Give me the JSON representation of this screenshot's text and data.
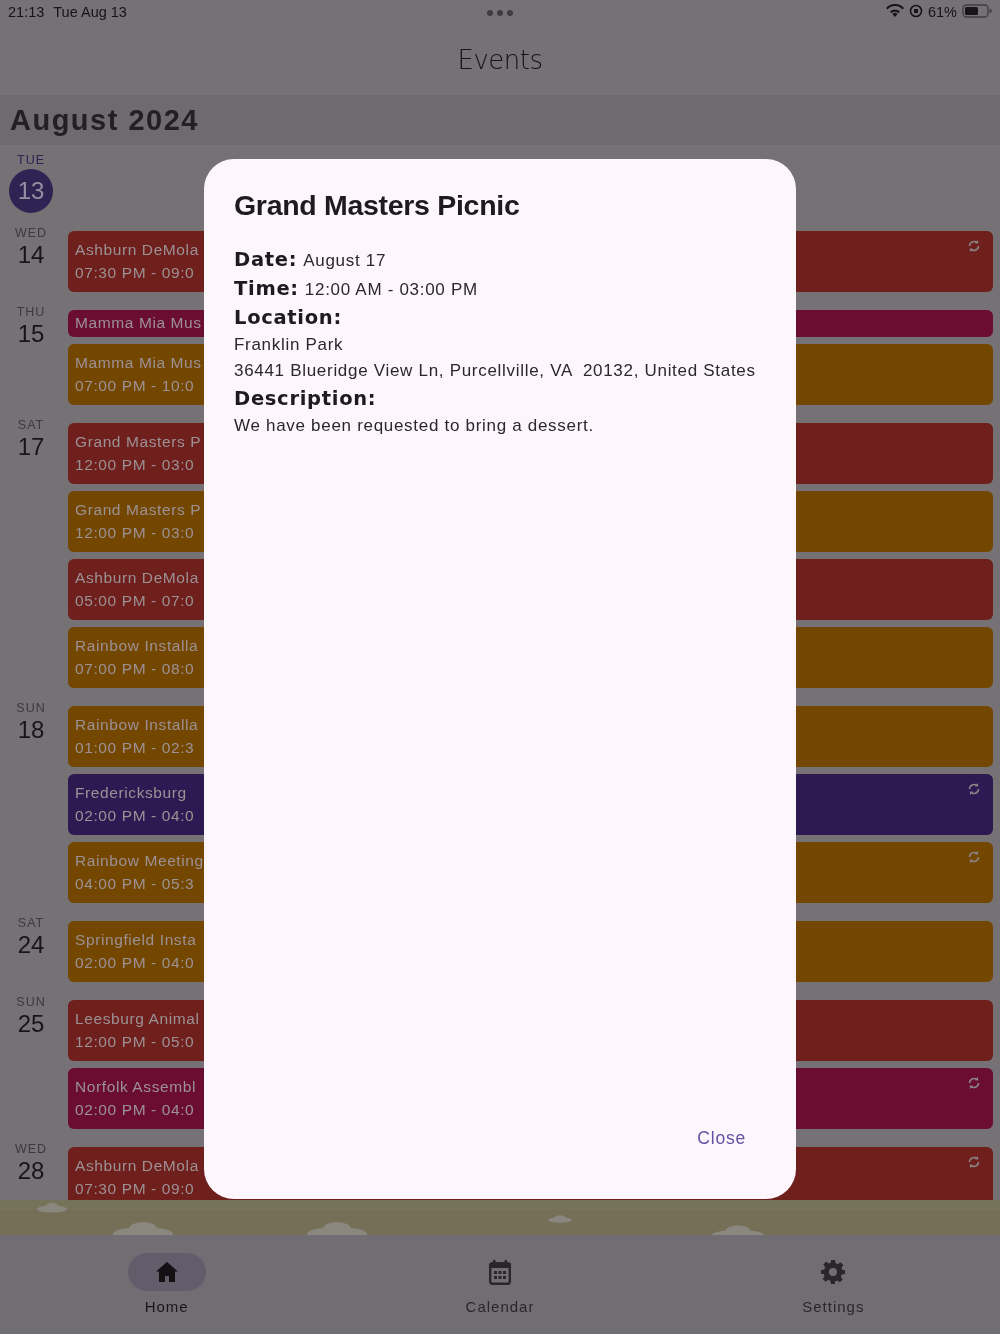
{
  "status_bar": {
    "time": "21:13",
    "date": "Tue Aug 13",
    "battery": "61%"
  },
  "header": {
    "title": "Events"
  },
  "month": "August 2024",
  "days": [
    {
      "weekday": "TUE",
      "day": "13",
      "today": true
    },
    {
      "weekday": "WED",
      "day": "14",
      "today": false,
      "events": [
        {
          "title": "Ashburn DeMola",
          "time": "07:30 PM - 09:0",
          "color": "#6f1f1c",
          "recurring": true
        }
      ]
    },
    {
      "weekday": "THU",
      "day": "15",
      "today": false,
      "events": [
        {
          "title": "Mamma Mia Mus",
          "color": "#6a0d30",
          "recurring": false
        },
        {
          "title": "Mamma Mia Mus",
          "time": "07:00 PM - 10:0",
          "color": "#744700",
          "recurring": false
        }
      ]
    },
    {
      "weekday": "SAT",
      "day": "17",
      "today": false,
      "events": [
        {
          "title": "Grand Masters P",
          "time": "12:00 PM - 03:0",
          "color": "#6f1f1c",
          "recurring": false
        },
        {
          "title": "Grand Masters P",
          "time": "12:00 PM - 03:0",
          "color": "#744700",
          "recurring": false
        },
        {
          "title": "Ashburn DeMola",
          "time": "05:00 PM - 07:0",
          "color": "#6f1f1c",
          "recurring": false
        },
        {
          "title": "Rainbow Installa",
          "time": "07:00 PM - 08:0",
          "color": "#744700",
          "recurring": false
        }
      ]
    },
    {
      "weekday": "SUN",
      "day": "18",
      "today": false,
      "events": [
        {
          "title": "Rainbow Installa",
          "time": "01:00 PM - 02:3",
          "color": "#744700",
          "recurring": false
        },
        {
          "title": "Fredericksburg",
          "time": "02:00 PM - 04:0",
          "color": "#2e1a52",
          "recurring": true
        },
        {
          "title": "Rainbow Meeting",
          "time": "04:00 PM - 05:3",
          "color": "#744700",
          "recurring": true
        }
      ]
    },
    {
      "weekday": "SAT",
      "day": "24",
      "today": false,
      "events": [
        {
          "title": "Springfield Insta",
          "time": "02:00 PM - 04:0",
          "color": "#744700",
          "recurring": false
        }
      ]
    },
    {
      "weekday": "SUN",
      "day": "25",
      "today": false,
      "events": [
        {
          "title": "Leesburg Animal",
          "time": "12:00 PM - 05:0",
          "color": "#6f1f1c",
          "recurring": false
        },
        {
          "title": "Norfolk Assembl",
          "time": "02:00 PM - 04:0",
          "color": "#6a0d30",
          "recurring": true
        }
      ]
    },
    {
      "weekday": "WED",
      "day": "28",
      "today": false,
      "events": [
        {
          "title": "Ashburn DeMola",
          "time": "07:30 PM - 09:0",
          "color": "#6f1f1c",
          "recurring": true
        }
      ]
    }
  ],
  "dialog": {
    "title": "Grand Masters Picnic",
    "fields": [
      {
        "kind": "inline",
        "label": "Date:",
        "value": "August 17"
      },
      {
        "kind": "inline",
        "label": "Time:",
        "value": "12:00 AM - 03:00 PM"
      },
      {
        "kind": "block",
        "label": "Location:",
        "lines": [
          "Franklin Park",
          "36441 Blueridge View Ln, Purcellville, VA  20132, United States"
        ]
      },
      {
        "kind": "block",
        "label": "Description:",
        "lines": [
          "We have been requested to bring a dessert."
        ]
      }
    ],
    "close": "Close"
  },
  "nav": [
    {
      "kind": "home",
      "label": "Home",
      "selected": true
    },
    {
      "kind": "calendar",
      "label": "Calendar",
      "selected": false
    },
    {
      "kind": "settings",
      "label": "Settings",
      "selected": false
    }
  ]
}
